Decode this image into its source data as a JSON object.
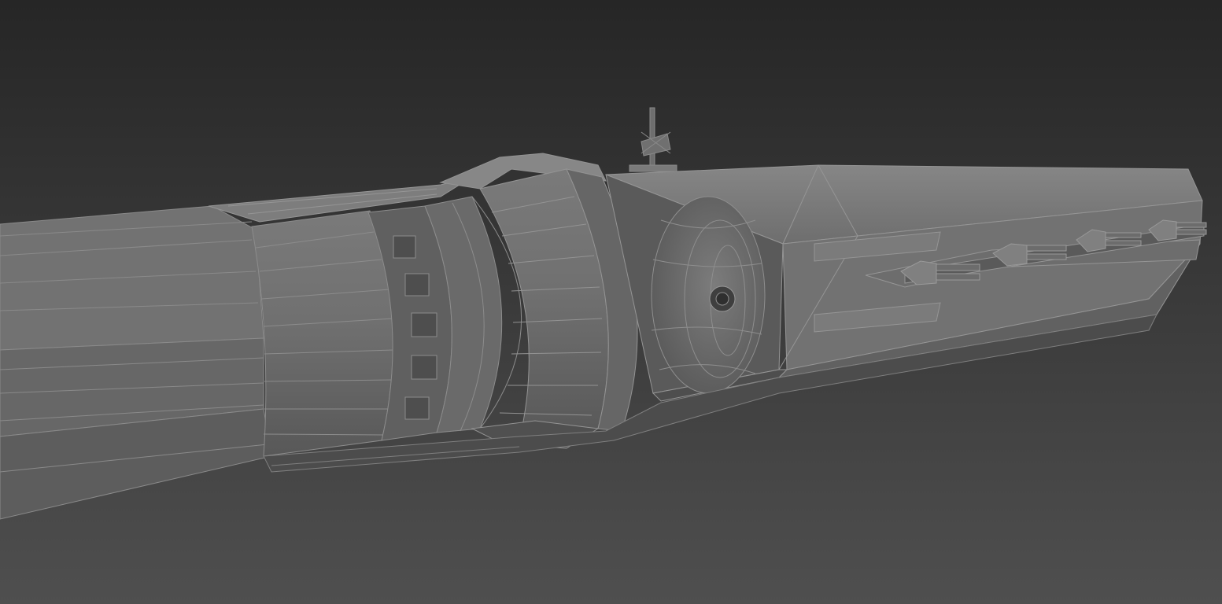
{
  "scene": {
    "colors": {
      "background_top": "#262626",
      "background_bottom": "#4e4e4e",
      "hull": "#6c6c6c",
      "hull_light": "#858585",
      "hull_dark": "#4a4a4a",
      "wire": "#8e8e8e",
      "edge": "#3a3a3a"
    }
  }
}
